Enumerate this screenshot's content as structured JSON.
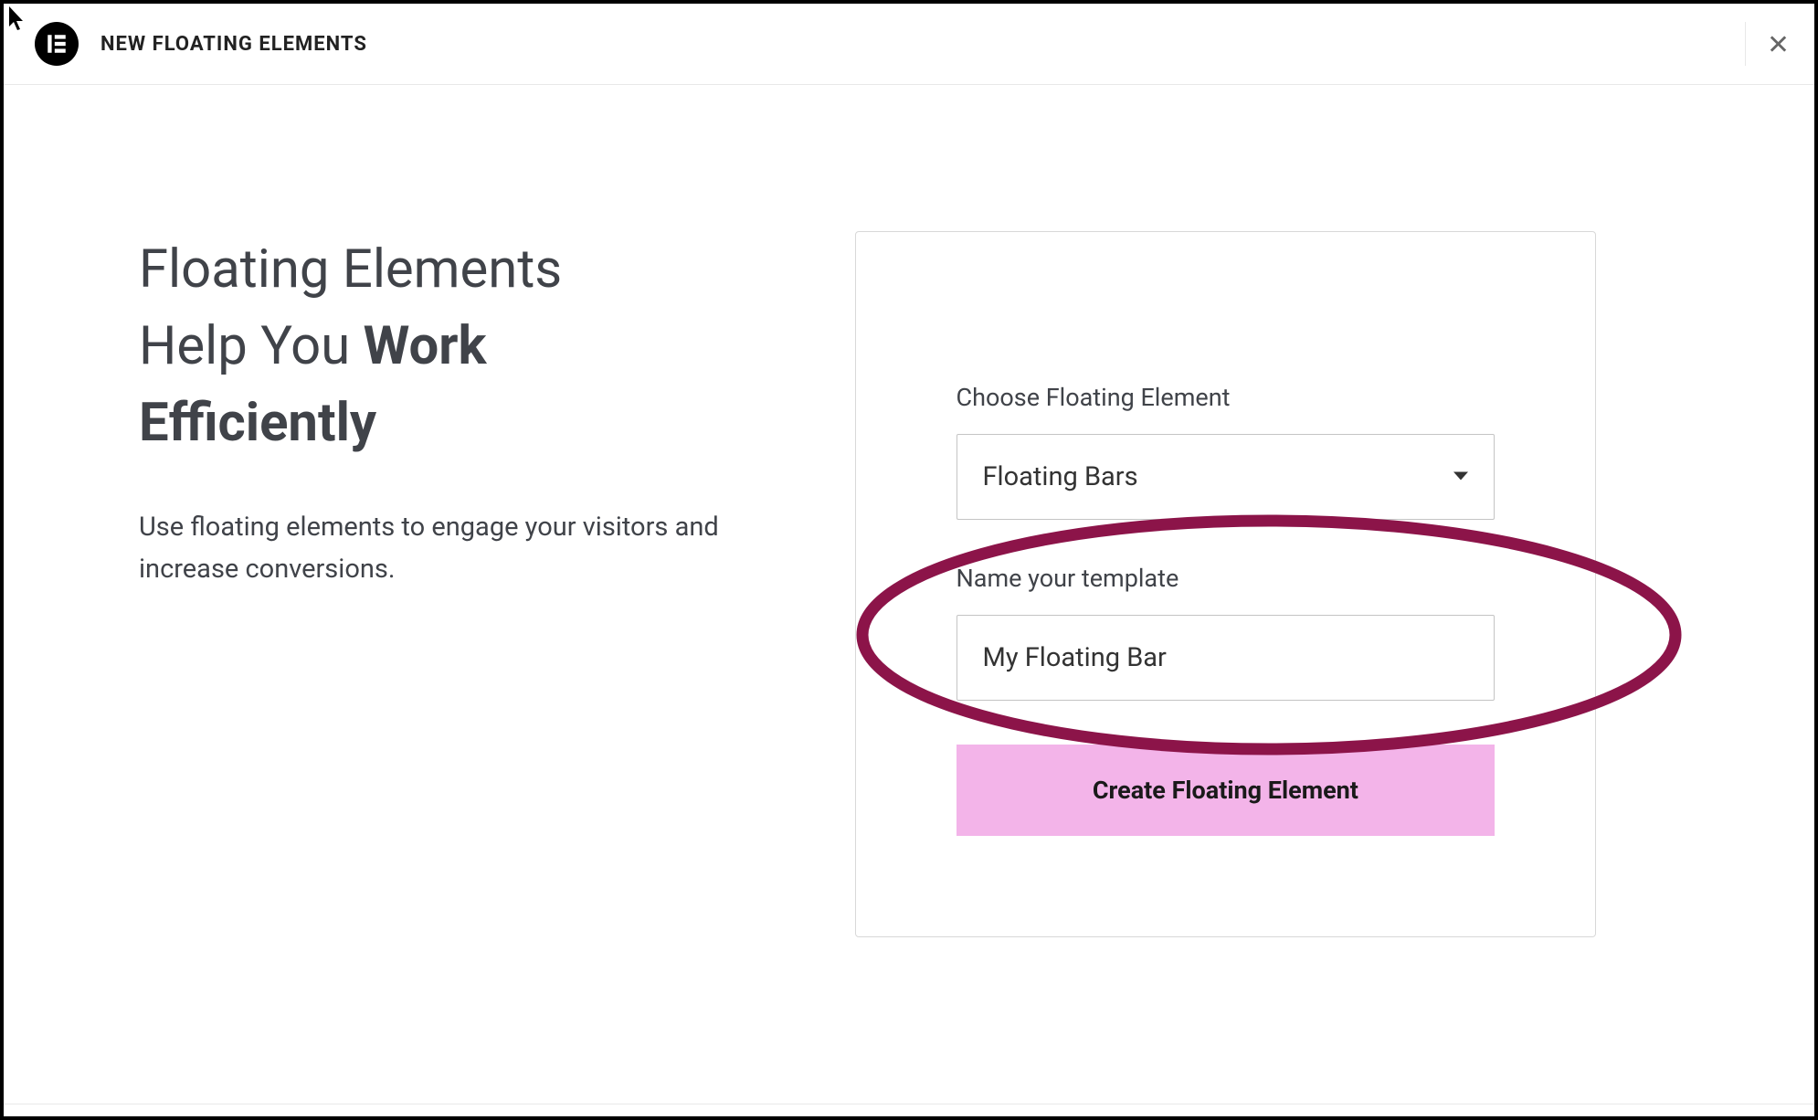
{
  "header": {
    "title": "NEW FLOATING ELEMENTS"
  },
  "hero": {
    "title_line1": "Floating Elements",
    "title_line2_a": "Help You ",
    "title_line2_b": "Work",
    "title_line3": "Efficiently",
    "subtitle": "Use floating elements to engage your visitors and increase conversions."
  },
  "form": {
    "element_label": "Choose Floating Element",
    "element_value": "Floating Bars",
    "name_label": "Name your template",
    "name_value": "My Floating Bar",
    "submit_label": "Create Floating Element"
  },
  "annotation": {
    "color": "#8c1449"
  }
}
